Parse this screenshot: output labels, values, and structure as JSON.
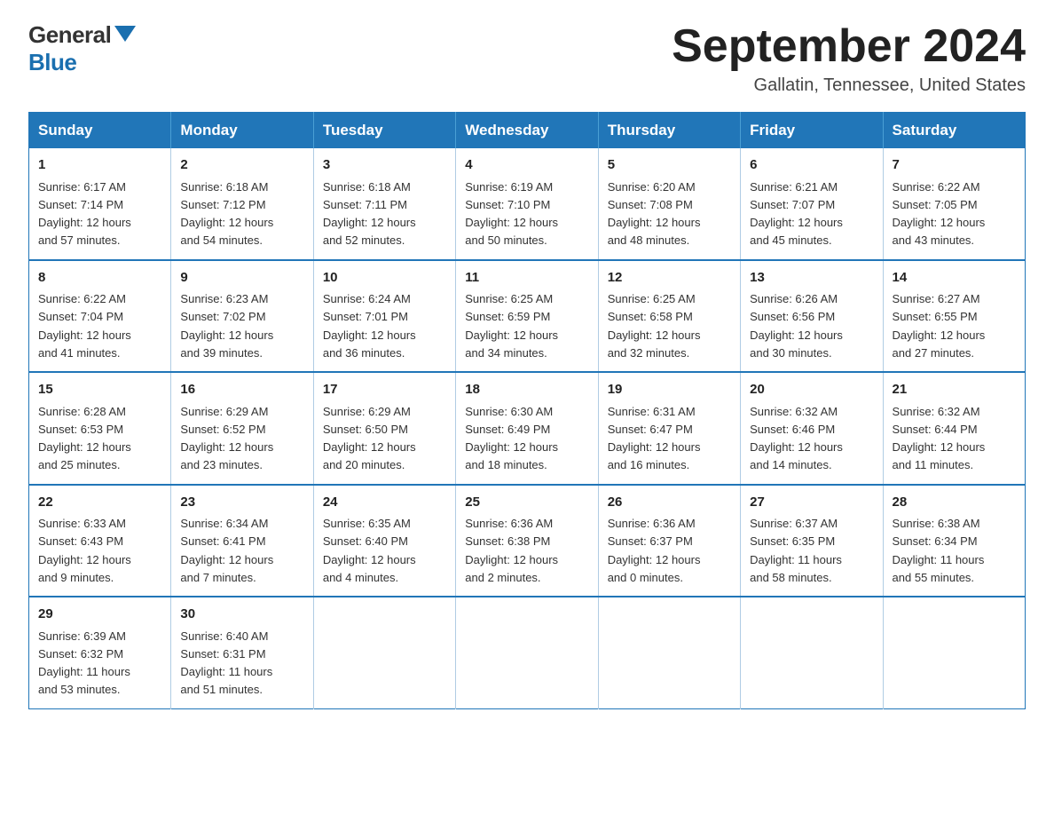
{
  "header": {
    "logo_general": "General",
    "logo_blue": "Blue",
    "title": "September 2024",
    "location": "Gallatin, Tennessee, United States"
  },
  "columns": [
    "Sunday",
    "Monday",
    "Tuesday",
    "Wednesday",
    "Thursday",
    "Friday",
    "Saturday"
  ],
  "weeks": [
    [
      {
        "day": "1",
        "sunrise": "6:17 AM",
        "sunset": "7:14 PM",
        "daylight": "12 hours and 57 minutes."
      },
      {
        "day": "2",
        "sunrise": "6:18 AM",
        "sunset": "7:12 PM",
        "daylight": "12 hours and 54 minutes."
      },
      {
        "day": "3",
        "sunrise": "6:18 AM",
        "sunset": "7:11 PM",
        "daylight": "12 hours and 52 minutes."
      },
      {
        "day": "4",
        "sunrise": "6:19 AM",
        "sunset": "7:10 PM",
        "daylight": "12 hours and 50 minutes."
      },
      {
        "day": "5",
        "sunrise": "6:20 AM",
        "sunset": "7:08 PM",
        "daylight": "12 hours and 48 minutes."
      },
      {
        "day": "6",
        "sunrise": "6:21 AM",
        "sunset": "7:07 PM",
        "daylight": "12 hours and 45 minutes."
      },
      {
        "day": "7",
        "sunrise": "6:22 AM",
        "sunset": "7:05 PM",
        "daylight": "12 hours and 43 minutes."
      }
    ],
    [
      {
        "day": "8",
        "sunrise": "6:22 AM",
        "sunset": "7:04 PM",
        "daylight": "12 hours and 41 minutes."
      },
      {
        "day": "9",
        "sunrise": "6:23 AM",
        "sunset": "7:02 PM",
        "daylight": "12 hours and 39 minutes."
      },
      {
        "day": "10",
        "sunrise": "6:24 AM",
        "sunset": "7:01 PM",
        "daylight": "12 hours and 36 minutes."
      },
      {
        "day": "11",
        "sunrise": "6:25 AM",
        "sunset": "6:59 PM",
        "daylight": "12 hours and 34 minutes."
      },
      {
        "day": "12",
        "sunrise": "6:25 AM",
        "sunset": "6:58 PM",
        "daylight": "12 hours and 32 minutes."
      },
      {
        "day": "13",
        "sunrise": "6:26 AM",
        "sunset": "6:56 PM",
        "daylight": "12 hours and 30 minutes."
      },
      {
        "day": "14",
        "sunrise": "6:27 AM",
        "sunset": "6:55 PM",
        "daylight": "12 hours and 27 minutes."
      }
    ],
    [
      {
        "day": "15",
        "sunrise": "6:28 AM",
        "sunset": "6:53 PM",
        "daylight": "12 hours and 25 minutes."
      },
      {
        "day": "16",
        "sunrise": "6:29 AM",
        "sunset": "6:52 PM",
        "daylight": "12 hours and 23 minutes."
      },
      {
        "day": "17",
        "sunrise": "6:29 AM",
        "sunset": "6:50 PM",
        "daylight": "12 hours and 20 minutes."
      },
      {
        "day": "18",
        "sunrise": "6:30 AM",
        "sunset": "6:49 PM",
        "daylight": "12 hours and 18 minutes."
      },
      {
        "day": "19",
        "sunrise": "6:31 AM",
        "sunset": "6:47 PM",
        "daylight": "12 hours and 16 minutes."
      },
      {
        "day": "20",
        "sunrise": "6:32 AM",
        "sunset": "6:46 PM",
        "daylight": "12 hours and 14 minutes."
      },
      {
        "day": "21",
        "sunrise": "6:32 AM",
        "sunset": "6:44 PM",
        "daylight": "12 hours and 11 minutes."
      }
    ],
    [
      {
        "day": "22",
        "sunrise": "6:33 AM",
        "sunset": "6:43 PM",
        "daylight": "12 hours and 9 minutes."
      },
      {
        "day": "23",
        "sunrise": "6:34 AM",
        "sunset": "6:41 PM",
        "daylight": "12 hours and 7 minutes."
      },
      {
        "day": "24",
        "sunrise": "6:35 AM",
        "sunset": "6:40 PM",
        "daylight": "12 hours and 4 minutes."
      },
      {
        "day": "25",
        "sunrise": "6:36 AM",
        "sunset": "6:38 PM",
        "daylight": "12 hours and 2 minutes."
      },
      {
        "day": "26",
        "sunrise": "6:36 AM",
        "sunset": "6:37 PM",
        "daylight": "12 hours and 0 minutes."
      },
      {
        "day": "27",
        "sunrise": "6:37 AM",
        "sunset": "6:35 PM",
        "daylight": "11 hours and 58 minutes."
      },
      {
        "day": "28",
        "sunrise": "6:38 AM",
        "sunset": "6:34 PM",
        "daylight": "11 hours and 55 minutes."
      }
    ],
    [
      {
        "day": "29",
        "sunrise": "6:39 AM",
        "sunset": "6:32 PM",
        "daylight": "11 hours and 53 minutes."
      },
      {
        "day": "30",
        "sunrise": "6:40 AM",
        "sunset": "6:31 PM",
        "daylight": "11 hours and 51 minutes."
      },
      null,
      null,
      null,
      null,
      null
    ]
  ],
  "labels": {
    "sunrise": "Sunrise:",
    "sunset": "Sunset:",
    "daylight": "Daylight:"
  }
}
